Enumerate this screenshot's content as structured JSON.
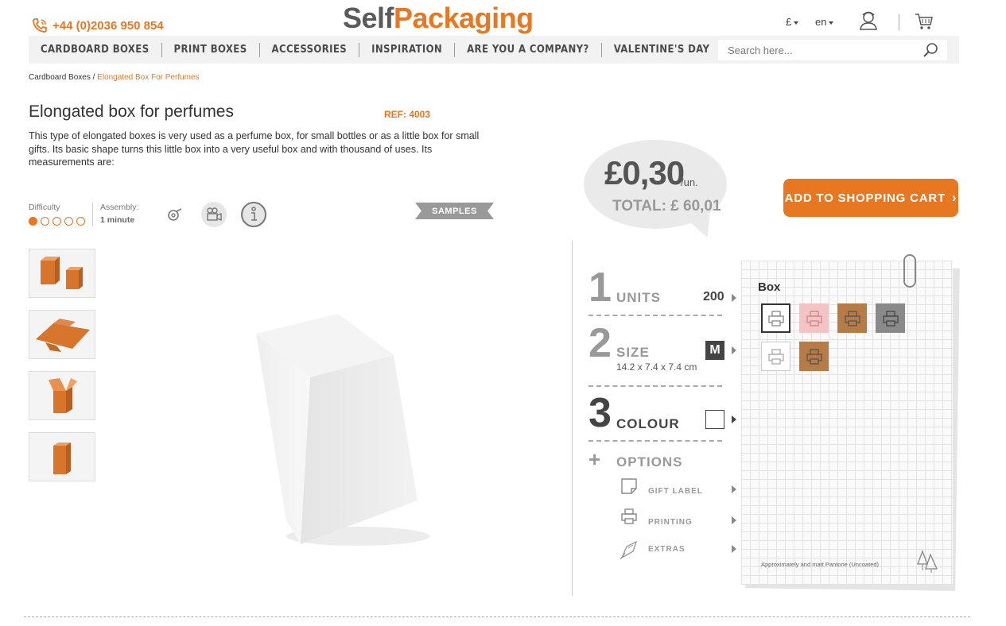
{
  "header": {
    "phone": "+44 (0)2036 950 854",
    "logo_part1": "Self",
    "logo_part2": "Packaging",
    "currency": "£",
    "language": "en"
  },
  "nav": {
    "items": [
      "CARDBOARD BOXES",
      "PRINT BOXES",
      "ACCESSORIES",
      "INSPIRATION",
      "ARE YOU A COMPANY?",
      "VALENTINE'S DAY"
    ],
    "search_placeholder": "Search here..."
  },
  "breadcrumb": {
    "parent": "Cardboard Boxes",
    "separator": "/",
    "current": "Elongated Box For Perfumes"
  },
  "product": {
    "title": "Elongated box for perfumes",
    "ref": "REF: 4003",
    "description": "This type of elongated boxes is very used as a perfume box, for small bottles or as a little box for small gifts. Its basic shape turns this little box into a very useful box and with thousand of uses. Its measurements are:",
    "difficulty_label": "Difficulty",
    "difficulty_level": 1,
    "difficulty_max": 5,
    "assembly_label": "Assembly:",
    "assembly_value": "1 minute",
    "samples_label": "SAMPLES"
  },
  "pricing": {
    "price": "£0,30",
    "unit": "/un.",
    "total": "TOTAL: £ 60,01",
    "cart_button": "ADD TO SHOPPING CART"
  },
  "config": {
    "steps": [
      {
        "num": "1",
        "label": "UNITS",
        "value": "200"
      },
      {
        "num": "2",
        "label": "SIZE",
        "value": "M",
        "detail": "14.2 x 7.4 x 7.4 cm"
      },
      {
        "num": "3",
        "label": "COLOUR"
      }
    ],
    "options_label": "OPTIONS",
    "options": [
      "GIFT LABEL",
      "PRINTING",
      "EXTRAS"
    ]
  },
  "palette": {
    "title": "Box",
    "swatches": [
      "#ffffff",
      "#f4c4c4",
      "#b77c46",
      "#8a8a8a",
      "#ffffff",
      "#b77c46"
    ],
    "note": "Approximately and matt Pantone (Uncoated)"
  },
  "colors": {
    "accent": "#e87722",
    "nav_bg": "#f2f2f2"
  }
}
